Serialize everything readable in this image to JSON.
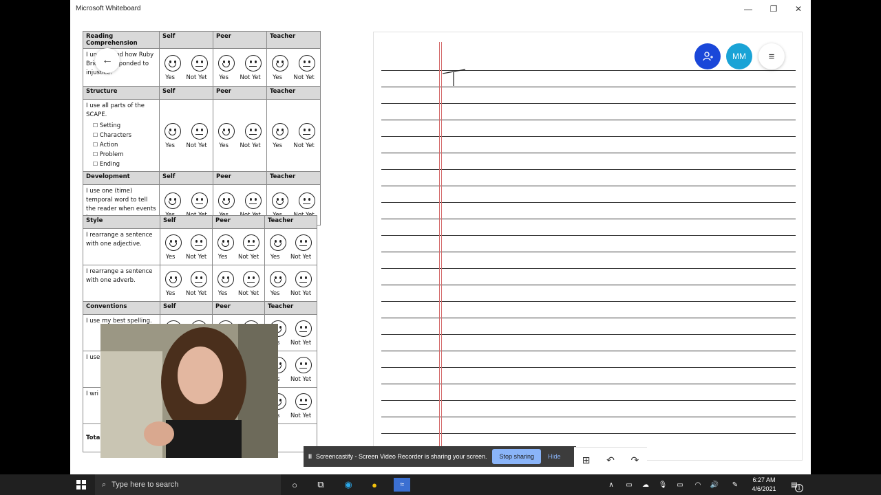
{
  "window": {
    "title": "Microsoft Whiteboard",
    "minimize": "—",
    "restore": "❐",
    "close": "✕"
  },
  "rubric_top": [
    {
      "category": "Reading Comprehension",
      "cols": [
        "Self",
        "Peer",
        "Teacher"
      ],
      "rows": [
        {
          "desc": "I understand how Ruby Bridges responded to injustice.",
          "items": []
        }
      ]
    },
    {
      "category": "Structure",
      "cols": [
        "Self",
        "Peer",
        "Teacher"
      ],
      "rows": [
        {
          "desc": "I use all parts of the SCAPE.",
          "items": [
            "Setting",
            "Characters",
            "Action",
            "Problem",
            "Ending"
          ]
        }
      ]
    },
    {
      "category": "Development",
      "cols": [
        "Self",
        "Peer",
        "Teacher"
      ],
      "rows": [
        {
          "desc": "I use one (time) temporal word to tell the reader when events happen.",
          "items": []
        }
      ]
    }
  ],
  "rubric_bottom": [
    {
      "category": "Style",
      "cols": [
        "Self",
        "Peer",
        "Teacher"
      ],
      "rows": [
        {
          "desc": "I rearrange a sentence with one adjective.",
          "items": []
        },
        {
          "desc": "I rearrange a sentence with one adverb.",
          "items": []
        }
      ]
    },
    {
      "category": "Conventions",
      "cols": [
        "Self",
        "Peer",
        "Teacher"
      ],
      "rows": [
        {
          "desc": "I use my best spelling.",
          "items": []
        },
        {
          "desc": "I use",
          "items": []
        },
        {
          "desc": "I wri sent subj",
          "items": []
        }
      ]
    }
  ],
  "rubric_total": "Tota",
  "labels": {
    "yes": "Yes",
    "not_yet": "Not Yet"
  },
  "participants": {
    "initials": "MM"
  },
  "handwriting": "T",
  "share": {
    "pause_icon": "II",
    "message": "Screencastify - Screen Video Recorder is sharing your screen.",
    "stop": "Stop sharing",
    "hide": "Hide"
  },
  "toolbar": {
    "add": "⊞",
    "undo": "↶",
    "redo": "↷"
  },
  "taskbar": {
    "search_placeholder": "Type here to search",
    "time": "6:27 AM",
    "date": "4/6/2021",
    "notification_count": "1"
  },
  "colors": {
    "accent_blue": "#1a47d9",
    "teal": "#1aa3d6",
    "margin_red": "#d46a6a"
  }
}
